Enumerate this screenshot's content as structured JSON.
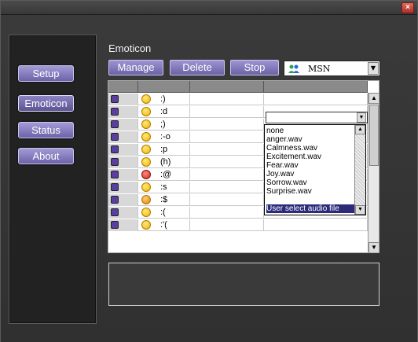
{
  "window": {
    "close_glyph": "×"
  },
  "sidebar": {
    "items": [
      {
        "label": "Setup",
        "active": false
      },
      {
        "label": "Emoticon",
        "active": true
      },
      {
        "label": "Status",
        "active": false
      },
      {
        "label": "About",
        "active": false
      }
    ]
  },
  "main": {
    "title": "Emoticon",
    "toolbar": {
      "manage": "Manage",
      "delete": "Delete",
      "stop": "Stop"
    },
    "protocol_select": {
      "value": "MSN",
      "icon": "msn-buddy-icon"
    }
  },
  "grid": {
    "rows": [
      {
        "code": ":)"
      },
      {
        "code": ":d"
      },
      {
        "code": ";)"
      },
      {
        "code": ":-o"
      },
      {
        "code": ":p"
      },
      {
        "code": "(h)"
      },
      {
        "code": ":@"
      },
      {
        "code": ":s"
      },
      {
        "code": ":$"
      },
      {
        "code": ":("
      },
      {
        "code": ":'("
      }
    ],
    "sound_dropdown": {
      "options": [
        "none",
        "anger.wav",
        "Calmness.wav",
        "Excitement.wav",
        "Fear.wav",
        "Joy.wav",
        "Sorrow.wav",
        "Surprise.wav",
        "User select audio file"
      ],
      "highlighted": "User select audio file"
    }
  },
  "colors": {
    "accent": "#7a70b8",
    "panel": "#222222",
    "background": "#3a3a3a"
  }
}
